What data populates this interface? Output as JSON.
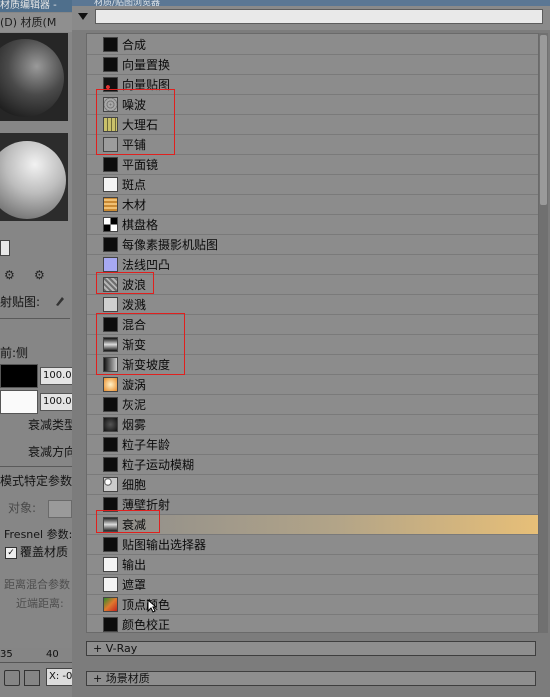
{
  "material_editor": {
    "title": "材质编辑器 -",
    "menu": "(D)  材质(M",
    "tools_glyphs": [
      "⚙",
      "⚙"
    ],
    "reflection_label": "射贴图:",
    "front_side": "前:侧",
    "value1": "100.0",
    "value2": "100.0",
    "falloff_type": "衰减类型",
    "falloff_direction": "衰减方向",
    "mode_params": "模式特定参数",
    "object_label": "对象:",
    "fresnel_label": "Fresnel 参数:",
    "override_label": "覆盖材质",
    "distance_blend": "距离混合参数",
    "near_distance": "近端距离:",
    "ruler_35": "35",
    "ruler_40": "40",
    "x_label": "X: -0"
  },
  "browser": {
    "title": "材质/贴图浏览器",
    "search_value": "",
    "items": [
      {
        "label": "合成",
        "icon": "black-swatch",
        "thumb": "#0c0c0c"
      },
      {
        "label": "向量置换",
        "icon": "black-swatch",
        "thumb": "#0c0c0c"
      },
      {
        "label": "向量贴图",
        "icon": "vector-map-swatch",
        "thumb": "#0c0c0c"
      },
      {
        "label": "噪波",
        "icon": "noise-swatch",
        "thumb": "#9a9a9a"
      },
      {
        "label": "大理石",
        "icon": "marble-swatch",
        "thumb": "#c9c06a"
      },
      {
        "label": "平铺",
        "icon": "tiles-swatch",
        "thumb": "#9c9c9c"
      },
      {
        "label": "平面镜",
        "icon": "black-swatch",
        "thumb": "#0c0c0c"
      },
      {
        "label": "斑点",
        "icon": "white-swatch",
        "thumb": "#f4f4f4"
      },
      {
        "label": "木材",
        "icon": "wood-swatch",
        "thumb": "#d9a34a"
      },
      {
        "label": "棋盘格",
        "icon": "checker-swatch",
        "thumb": "#ffffff"
      },
      {
        "label": "每像素摄影机贴图",
        "icon": "black-swatch",
        "thumb": "#0c0c0c"
      },
      {
        "label": "法线凹凸",
        "icon": "normal-bump-swatch",
        "thumb": "#a7a9f2"
      },
      {
        "label": "波浪",
        "icon": "waves-swatch",
        "thumb": "#8f8f8f"
      },
      {
        "label": "泼溅",
        "icon": "splat-swatch",
        "thumb": "#cfcfcf"
      },
      {
        "label": "混合",
        "icon": "black-swatch",
        "thumb": "#0c0c0c"
      },
      {
        "label": "渐变",
        "icon": "gradient-swatch",
        "thumb": "#7a7a7a"
      },
      {
        "label": "渐变坡度",
        "icon": "gradient-ramp-swatch",
        "thumb": "#5c5c5c"
      },
      {
        "label": "漩涡",
        "icon": "swirl-swatch",
        "thumb": "#f0a44a"
      },
      {
        "label": "灰泥",
        "icon": "black-swatch",
        "thumb": "#0c0c0c"
      },
      {
        "label": "烟雾",
        "icon": "smoke-swatch",
        "thumb": "#1a1a1a"
      },
      {
        "label": "粒子年龄",
        "icon": "black-swatch",
        "thumb": "#0c0c0c"
      },
      {
        "label": "粒子运动模糊",
        "icon": "black-swatch",
        "thumb": "#0c0c0c"
      },
      {
        "label": "细胞",
        "icon": "cellular-swatch",
        "thumb": "#bdbdbd"
      },
      {
        "label": "薄壁折射",
        "icon": "black-swatch",
        "thumb": "#0c0c0c"
      },
      {
        "label": "衰减",
        "icon": "falloff-swatch",
        "thumb": "#8a8a8a",
        "highlighted": true
      },
      {
        "label": "贴图输出选择器",
        "icon": "black-swatch",
        "thumb": "#0c0c0c"
      },
      {
        "label": "输出",
        "icon": "white-swatch",
        "thumb": "#f4f4f4"
      },
      {
        "label": "遮罩",
        "icon": "white-swatch",
        "thumb": "#f4f4f4"
      },
      {
        "label": "顶点颜色",
        "icon": "vertex-color-swatch",
        "thumb": "#d6702c"
      },
      {
        "label": "颜色校正",
        "icon": "black-swatch",
        "thumb": "#0c0c0c"
      }
    ],
    "groups": [
      {
        "label": "+ V-Ray"
      },
      {
        "label": "+ 场景材质"
      }
    ],
    "annotation_color": "#e0201e",
    "highlight_color": "#e7bf78"
  }
}
